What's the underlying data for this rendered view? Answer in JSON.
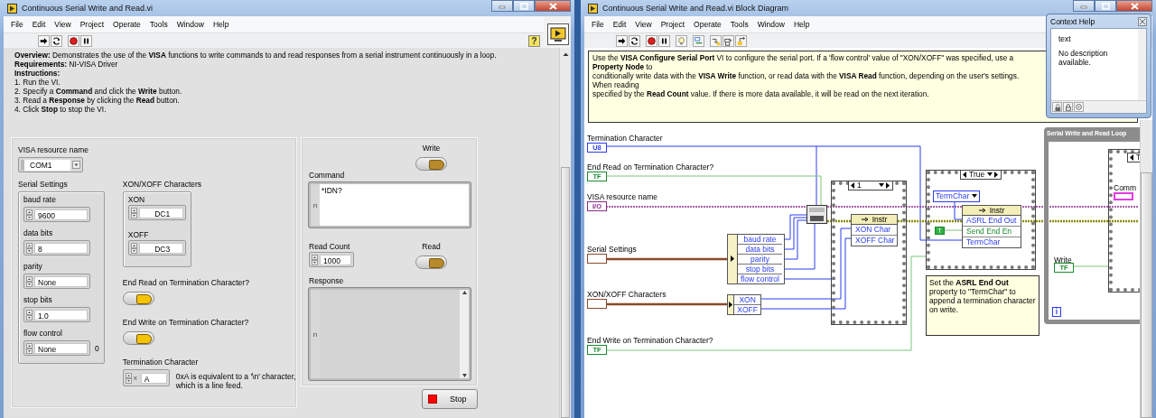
{
  "front_panel": {
    "window": {
      "title": "Continuous Serial Write and Read.vi"
    },
    "menu": [
      "File",
      "Edit",
      "View",
      "Project",
      "Operate",
      "Tools",
      "Window",
      "Help"
    ],
    "help_button": "?",
    "overview": "**Overview:** Demonstrates the use of the **VISA** functions to write commands to and read responses from a serial instrument continuously in a loop.",
    "requirements": "**Requirements:** NI-VISA Driver",
    "instructions_heading": "Instructions:",
    "steps": [
      "1. Run the VI.",
      "2. Specify a **Command** and click the **Write** button.",
      "3. Read a **Response** by clicking the **Read** button.",
      "4. Click **Stop** to stop the VI."
    ],
    "visa_resource": {
      "label": "VISA resource name",
      "value": "COM1"
    },
    "serial_settings": {
      "label": "Serial Settings",
      "fields": [
        {
          "label": "baud rate",
          "value": "9600"
        },
        {
          "label": "data bits",
          "value": "8"
        },
        {
          "label": "parity",
          "value": "None"
        },
        {
          "label": "stop bits",
          "value": "1.0"
        },
        {
          "label": "flow control",
          "value": "None",
          "indicator": "0"
        }
      ]
    },
    "xon_xoff": {
      "label": "XON/XOFF Characters",
      "fields": [
        {
          "label": "XON",
          "value": "DC1"
        },
        {
          "label": "XOFF",
          "value": "DC3"
        }
      ]
    },
    "end_read": {
      "label": "End Read on Termination Character?",
      "on": true
    },
    "end_write": {
      "label": "End Write on Termination Character?",
      "on": true
    },
    "termination": {
      "label": "Termination Character",
      "radix": "x",
      "value": "A",
      "note": "0xA is equivalent to a '\\n' character, which is a line feed."
    },
    "write": {
      "label": "Write",
      "on": false
    },
    "command": {
      "label": "Command",
      "display_mode": "n",
      "value": "*IDN?"
    },
    "read_count": {
      "label": "Read Count",
      "value": "1000"
    },
    "read": {
      "label": "Read",
      "on": false
    },
    "response": {
      "label": "Response",
      "display_mode": "n"
    },
    "stop_button": {
      "label": "Stop"
    }
  },
  "block_diagram": {
    "window": {
      "title": "Continuous Serial Write and Read.vi Block Diagram"
    },
    "menu": [
      "File",
      "Edit",
      "View",
      "Project",
      "Operate",
      "Tools",
      "Window",
      "Help"
    ],
    "comment": [
      "Use the **VISA Configure Serial Port** VI to configure the serial port. If a 'flow control' value of \"XON/XOFF\" was specified, use a **Property Node** to",
      "conditionally write data with the **VISA Write** function, or read data with the **VISA Read** function, depending on the user's settings. When reading",
      "specified by the **Read Count** value. If there is more data available, it will be read on the next iteration."
    ],
    "terminals": [
      {
        "label": "Termination Character",
        "kind": "numeric",
        "tag": "U8"
      },
      {
        "label": "End Read on Termination Character?",
        "kind": "boolean",
        "tag": "TF"
      },
      {
        "label": "VISA resource name",
        "kind": "refnum",
        "tag": "I/O"
      },
      {
        "label": "Serial Settings",
        "kind": "cluster"
      },
      {
        "label": "XON/XOFF Characters",
        "kind": "cluster"
      },
      {
        "label": "End Write on Termination Character?",
        "kind": "boolean",
        "tag": "TF"
      }
    ],
    "serial_unbundle": [
      "baud rate",
      "data bits",
      "parity",
      "stop bits",
      "flow control"
    ],
    "xon_unbundle": [
      "XON",
      "XOFF"
    ],
    "flow_case": {
      "selector": "1",
      "node": {
        "reference": "Instr",
        "properties": [
          {
            "name": "XON Char",
            "kind": "numeric"
          },
          {
            "name": "XOFF Char",
            "kind": "numeric"
          }
        ]
      }
    },
    "term_case": {
      "selector": "True",
      "constant": "TermChar",
      "bool_constant": "T",
      "node": {
        "reference": "Instr",
        "properties": [
          {
            "name": "ASRL End Out",
            "kind": "numeric"
          },
          {
            "name": "Send End En",
            "kind": "boolean"
          },
          {
            "name": "TermChar",
            "kind": "numeric"
          }
        ]
      },
      "comment": "Set the **ASRL End Out** property to \"TermChar\" to append a termination character on write."
    },
    "loop": {
      "label": "Serial Write and Read Loop",
      "inner_selector": "T",
      "command_label": "Comm",
      "write_label": "Write",
      "write_tag": "TF",
      "iteration": "i"
    }
  },
  "context_help": {
    "title": "Context Help",
    "heading": "text",
    "body": "No description available."
  }
}
